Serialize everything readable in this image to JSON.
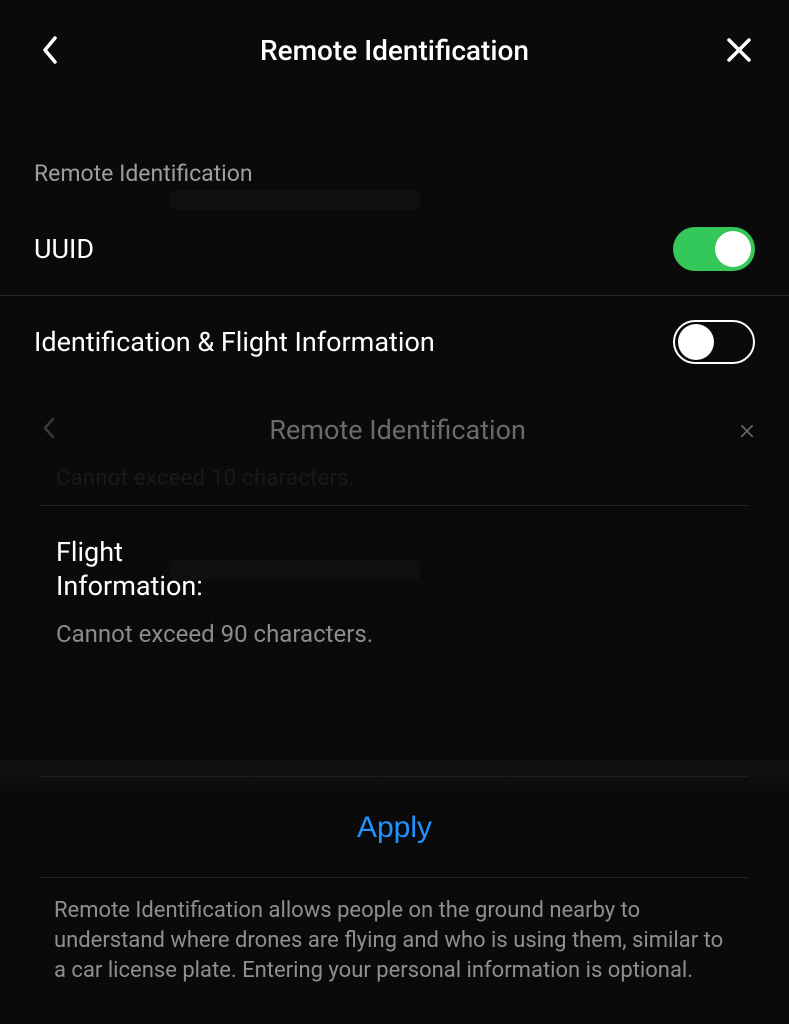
{
  "header": {
    "title": "Remote Identification"
  },
  "section_label": "Remote Identification",
  "rows": {
    "uuid_label": "UUID",
    "uuid_on": true,
    "ident_label": "Identification & Flight Information",
    "ident_on": false
  },
  "ghost": {
    "title": "Remote Identification",
    "prev_hint": "Cannot exceed 10 characters."
  },
  "flight_info": {
    "label": "Flight Information:",
    "hint": "Cannot exceed 90 characters."
  },
  "apply_label": "Apply",
  "footer": "Remote Identification allows people on the ground nearby to understand where drones are flying and who is using them, similar to a car license plate. Entering your personal information is optional."
}
